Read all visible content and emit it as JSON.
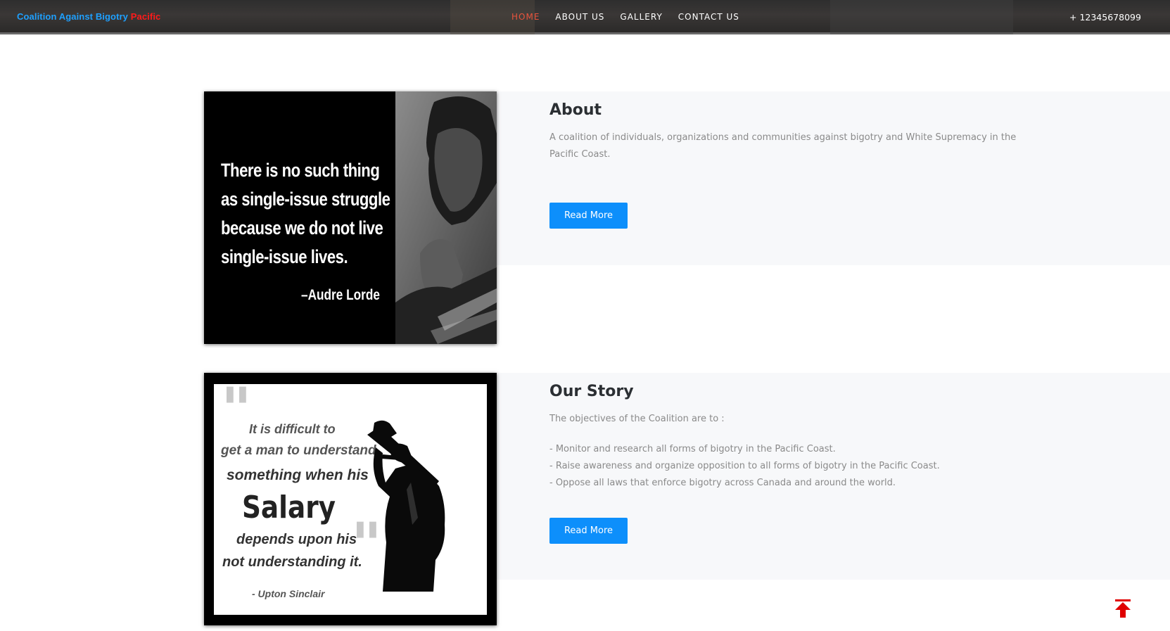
{
  "header": {
    "brand_part1": "Coalition Against Bigotry",
    "brand_part2": "Pacific",
    "nav": [
      "HOME",
      "ABOUT US",
      "GALLERY",
      "CONTACT US"
    ],
    "active_nav": "HOME",
    "phone": "+ 12345678099"
  },
  "about": {
    "title": "About",
    "text": "A coalition of individuals, organizations and communities against bigotry and White Supremacy in the Pacific Coast.",
    "button": "Read More",
    "image_quote_lines": [
      "There is no such thing",
      "as single-issue struggle",
      "because we do not live",
      "single-issue lives."
    ],
    "image_quote_author": "–Audre Lorde"
  },
  "story": {
    "title": "Our Story",
    "intro": "The objectives of the Coalition are to :",
    "objectives": [
      "- Monitor and research all forms of bigotry in the Pacific Coast.",
      "- Raise awareness and organize opposition to all forms of bigotry in the Pacific Coast.",
      "- Oppose all laws that enforce bigotry across Canada and around the world."
    ],
    "button": "Read More",
    "image_quote_lines": [
      "It is difficult to",
      "get a man to understand",
      "something when his",
      "Salary",
      "depends upon his",
      "not understanding it."
    ],
    "image_quote_author": "- Upton Sinclair"
  },
  "colors": {
    "brand_blue": "#1ea0ff",
    "brand_red": "#ff1a1a",
    "nav_active": "#e8543d",
    "button_blue": "#0d8ffb",
    "scroll_top_red": "#e00000"
  },
  "icons": {
    "scroll_top": "arrow-up-icon"
  }
}
